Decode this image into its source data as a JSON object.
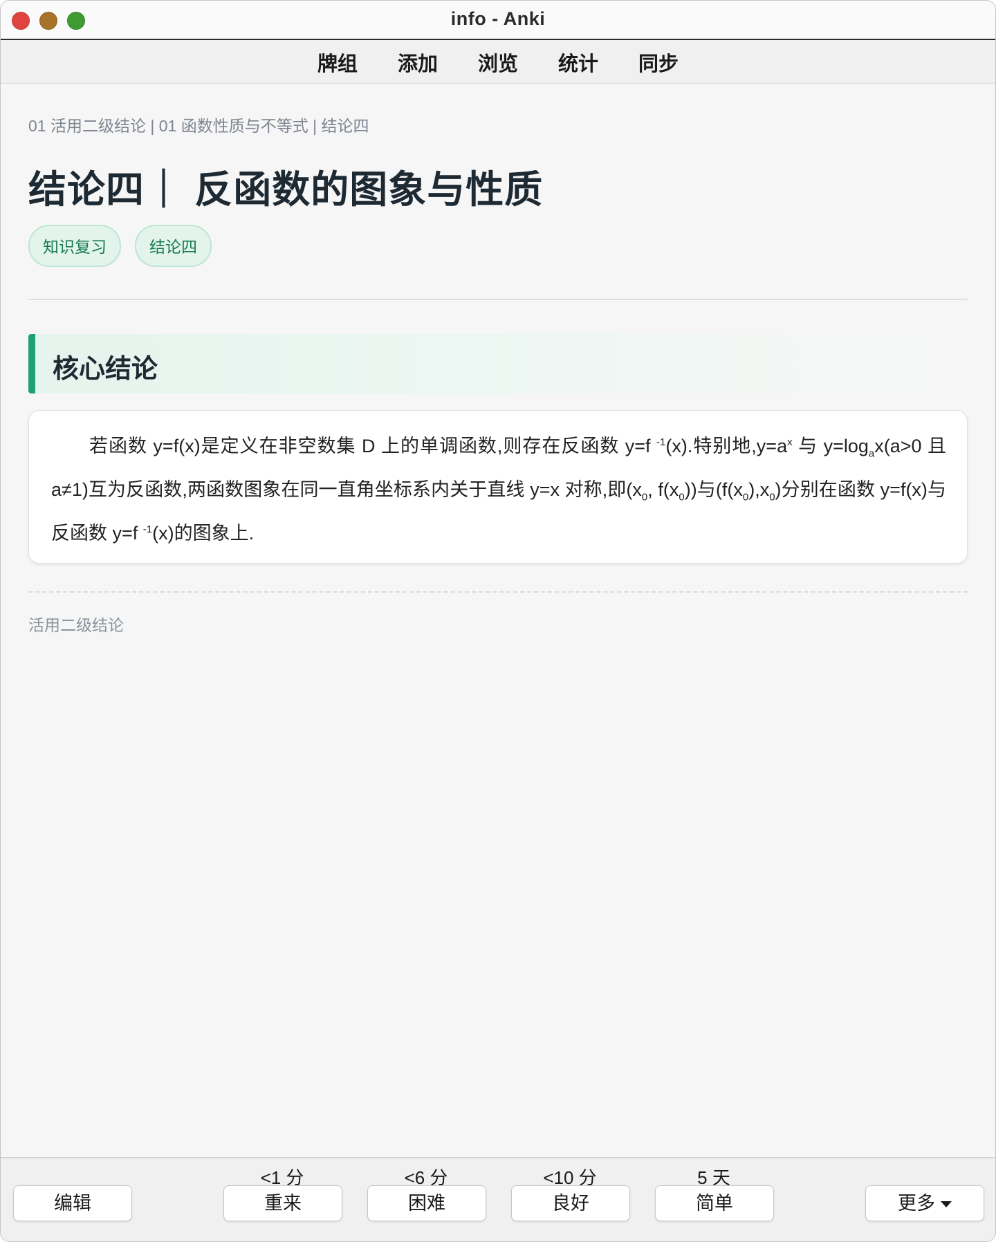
{
  "window": {
    "title": "info - Anki"
  },
  "toolbar": {
    "items": [
      "牌组",
      "添加",
      "浏览",
      "统计",
      "同步"
    ]
  },
  "card": {
    "breadcrumb": "01 活用二级结论 | 01 函数性质与不等式 | 结论四",
    "title": "结论四｜ 反函数的图象与性质",
    "tags": [
      "知识复习",
      "结论四"
    ],
    "section_heading": "核心结论",
    "body": {
      "p1": "若函数 y=f(x)是定义在非空数集 D 上的单调函数,则存在反函数 y=f ",
      "sup1": "-1",
      "p2": "(x).特别地,y=a",
      "sup2": "x",
      "p3": " 与 y=log",
      "sub1": "a",
      "p4": "x(a>0 且 a≠1)互为反函数,两函数图象在同一直角坐标系内关于直线 y=x 对称,即(x",
      "sub2": "0",
      "p5": ", f(x",
      "sub3": "0",
      "p6": "))与(f(x",
      "sub4": "0",
      "p7": "),x",
      "sub5": "0",
      "p8": ")分别在函数 y=f(x)与反函数 y=f ",
      "sup3": "-1",
      "p9": "(x)的图象上."
    },
    "footer_note": "活用二级结论"
  },
  "answer_bar": {
    "edit_label": "编辑",
    "more_label": "更多",
    "buttons": [
      {
        "label": "重来",
        "interval": "<1 分"
      },
      {
        "label": "困难",
        "interval": "<6 分"
      },
      {
        "label": "良好",
        "interval": "<10 分"
      },
      {
        "label": "简单",
        "interval": "5 天"
      }
    ]
  }
}
